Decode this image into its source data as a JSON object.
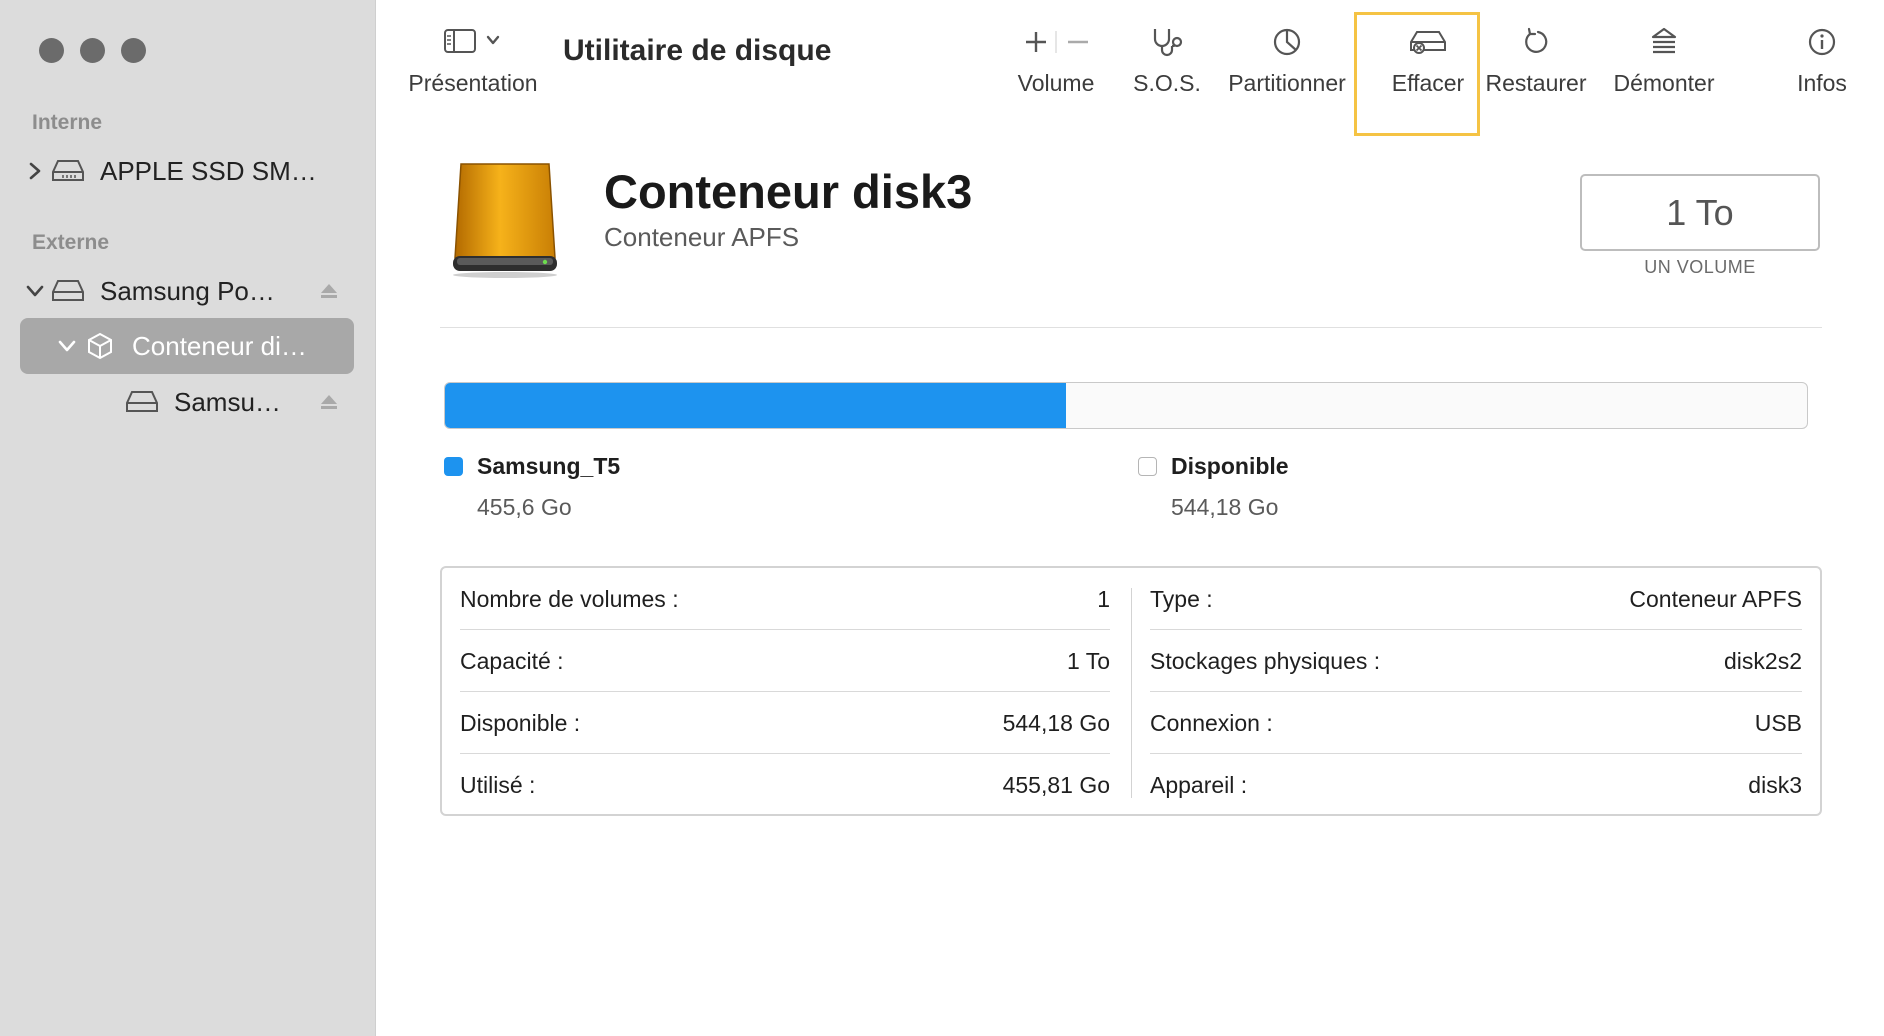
{
  "window": {
    "title": "Utilitaire de disque"
  },
  "sidebar": {
    "sections": [
      {
        "label": "Interne"
      },
      {
        "label": "Externe"
      }
    ],
    "items": [
      {
        "label": "APPLE SSD SM…",
        "icon": "internal-disk-icon"
      },
      {
        "label": "Samsung Po…",
        "icon": "external-disk-icon"
      },
      {
        "label": "Conteneur di…",
        "icon": "container-icon"
      },
      {
        "label": "Samsu…",
        "icon": "volume-disk-icon"
      }
    ]
  },
  "toolbar": {
    "presentation": "Présentation",
    "volume": "Volume",
    "sos": "S.O.S.",
    "partition": "Partitionner",
    "erase": "Effacer",
    "restore": "Restaurer",
    "unmount": "Démonter",
    "info": "Infos"
  },
  "disk": {
    "name": "Conteneur disk3",
    "type": "Conteneur APFS",
    "capacity": "1 To",
    "volume_count_caption": "UN VOLUME"
  },
  "usage": {
    "used_fraction": 0.4558,
    "used_color": "#1d93ef",
    "segments": [
      {
        "name": "Samsung_T5",
        "value": "455,6 Go",
        "color": "#1d93ef"
      },
      {
        "name": "Disponible",
        "value": "544,18 Go",
        "color": "#ffffff"
      }
    ]
  },
  "info": {
    "left": [
      {
        "label": "Nombre de volumes :",
        "value": "1"
      },
      {
        "label": "Capacité :",
        "value": "1 To"
      },
      {
        "label": "Disponible :",
        "value": "544,18 Go"
      },
      {
        "label": "Utilisé :",
        "value": "455,81 Go"
      }
    ],
    "right": [
      {
        "label": "Type :",
        "value": "Conteneur APFS"
      },
      {
        "label": "Stockages physiques :",
        "value": "disk2s2"
      },
      {
        "label": "Connexion :",
        "value": "USB"
      },
      {
        "label": "Appareil :",
        "value": "disk3"
      }
    ]
  },
  "colors": {
    "highlight": "#f5c344",
    "sidebar_bg": "#dcdcdc",
    "selection": "#a8a8a8"
  }
}
